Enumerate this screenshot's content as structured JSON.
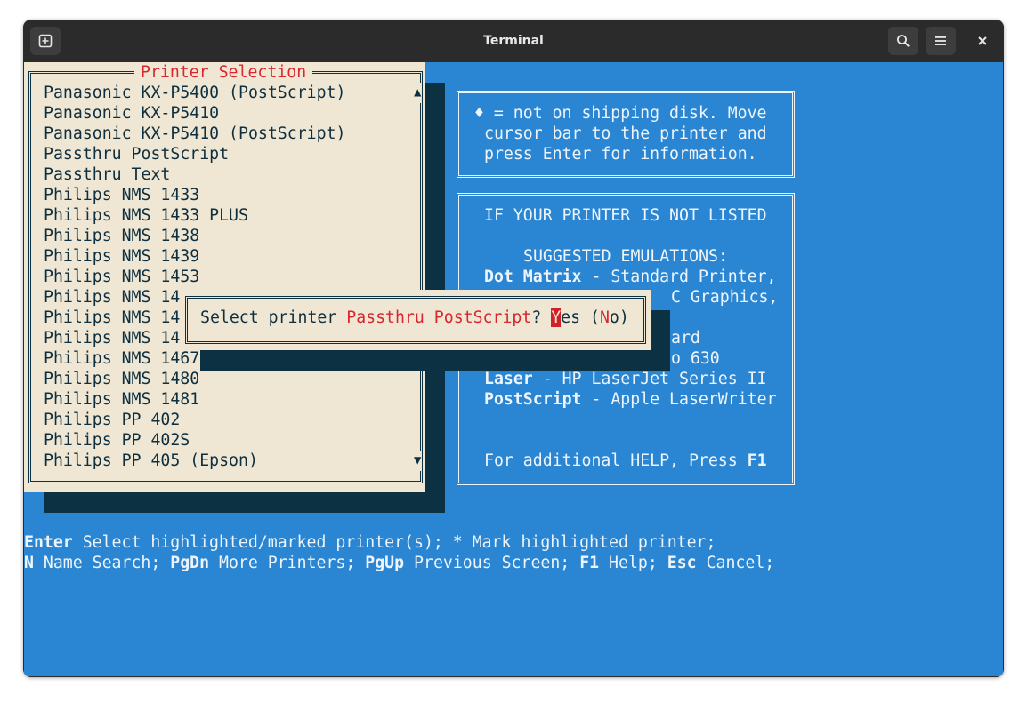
{
  "window": {
    "title": "Terminal"
  },
  "titlebar": {
    "new_tab_icon": "new-tab-icon",
    "search_icon": "search-icon",
    "menu_icon": "hamburger-menu-icon",
    "close_icon": "close-icon"
  },
  "printer_list": {
    "title": "Printer Selection",
    "items": [
      "Panasonic KX-P5400 (PostScript)",
      "Panasonic KX-P5410",
      "Panasonic KX-P5410 (PostScript)",
      "Passthru PostScript",
      "Passthru Text",
      "Philips NMS 1433",
      "Philips NMS 1433 PLUS",
      "Philips NMS 1438",
      "Philips NMS 1439",
      "Philips NMS 1453",
      "Philips NMS 14",
      "Philips NMS 14",
      "Philips NMS 14",
      "Philips NMS 1467",
      "Philips NMS 1480",
      "Philips NMS 1481",
      "Philips PP 402",
      "Philips PP 402S",
      "Philips PP 405 (Epson)"
    ],
    "scroll_up": "▲",
    "scroll_down": "▼"
  },
  "info_box": {
    "line1": "♦ = not on shipping disk. Move",
    "line2": "cursor bar to the printer and",
    "line3": "press Enter for information."
  },
  "help_box": {
    "heading": "IF YOUR PRINTER IS NOT LISTED",
    "subheading": "SUGGESTED EMULATIONS:",
    "rows": [
      {
        "label": "Dot Matrix",
        "text": " - Standard Printer,"
      },
      {
        "label": "",
        "text": "C Graphics,"
      },
      {
        "label": "",
        "text": "ard"
      },
      {
        "label": "",
        "text": "o 630"
      },
      {
        "label": "Laser",
        "text": " - HP LaserJet Series II"
      },
      {
        "label": "PostScript",
        "text": " - Apple LaserWriter"
      }
    ],
    "footer_text": "For additional HELP, Press ",
    "footer_key": "F1"
  },
  "dialog": {
    "prefix": "Select printer ",
    "printer": "Passthru PostScript",
    "question": "? ",
    "yes_hotkey": "Y",
    "yes_rest": "es",
    "open_paren": " (",
    "no_hotkey": "N",
    "no_rest": "o)"
  },
  "status_bar": {
    "line1": [
      {
        "key": "Enter",
        "text": " Select highlighted/marked printer(s); "
      },
      {
        "key": "",
        "text": "* Mark highlighted printer;"
      }
    ],
    "line2": [
      {
        "key": "N",
        "text": " Name Search; "
      },
      {
        "key": "PgDn",
        "text": " More Printers; "
      },
      {
        "key": "PgUp",
        "text": " Previous Screen; "
      },
      {
        "key": "F1",
        "text": " Help; "
      },
      {
        "key": "Esc",
        "text": " Cancel;"
      }
    ]
  },
  "colors": {
    "terminal_bg": "#2a86d2",
    "panel_bg": "#efe7d4",
    "shadow": "#0b3142",
    "accent_red": "#d8272e"
  }
}
